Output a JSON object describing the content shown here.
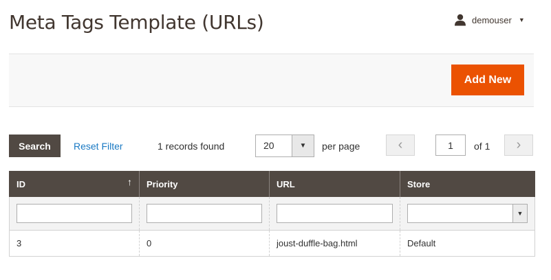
{
  "page": {
    "title": "Meta Tags Template (URLs)"
  },
  "user": {
    "name": "demouser",
    "icon": "user-icon"
  },
  "actions": {
    "add_new_label": "Add New",
    "accent_color": "#eb5202"
  },
  "toolbar": {
    "search_label": "Search",
    "reset_label": "Reset Filter",
    "records_text": "1 records found",
    "per_page_value": "20",
    "per_page_label": "per page",
    "current_page": "1",
    "of_total": "of 1"
  },
  "grid": {
    "columns": [
      {
        "label": "ID"
      },
      {
        "label": "Priority"
      },
      {
        "label": "URL"
      },
      {
        "label": "Store"
      }
    ],
    "sort_indicator": "↑",
    "rows": [
      {
        "id": "3",
        "priority": "0",
        "url": "joust-duffle-bag.html",
        "store": "Default"
      }
    ]
  }
}
